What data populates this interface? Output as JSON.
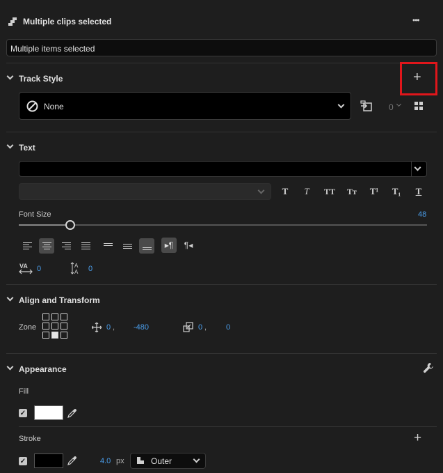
{
  "header": {
    "title": "Multiple clips selected",
    "more_label": "•••"
  },
  "clip_name": {
    "value": "Multiple items selected"
  },
  "track_style": {
    "title": "Track Style",
    "add_label": "+",
    "style_value": "None",
    "count_value": "0"
  },
  "text": {
    "title": "Text",
    "font_value": "",
    "font_style_value": "",
    "style_buttons": [
      "T",
      "T",
      "TT",
      "Tт",
      "T¹",
      "T₁",
      "T"
    ],
    "font_size_label": "Font Size",
    "font_size_value": "48",
    "font_size_fraction": 0.126,
    "kerning_value": "0",
    "leading_value": "0"
  },
  "align_transform": {
    "title": "Align and Transform",
    "zone_label": "Zone",
    "position_x": "0",
    "position_y": "-480",
    "scale_x": "0",
    "scale_y": "0",
    "comma": ","
  },
  "appearance": {
    "title": "Appearance",
    "fill_label": "Fill",
    "fill_checked": true,
    "fill_color": "#ffffff",
    "stroke_label": "Stroke",
    "stroke_checked": true,
    "stroke_color": "#000000",
    "stroke_width": "4.0",
    "stroke_unit": "px",
    "stroke_position": "Outer",
    "add_stroke_label": "+"
  },
  "colors": {
    "accent": "#4a9dea",
    "highlight_box": "#e0161b",
    "background": "#1e1e1e"
  }
}
